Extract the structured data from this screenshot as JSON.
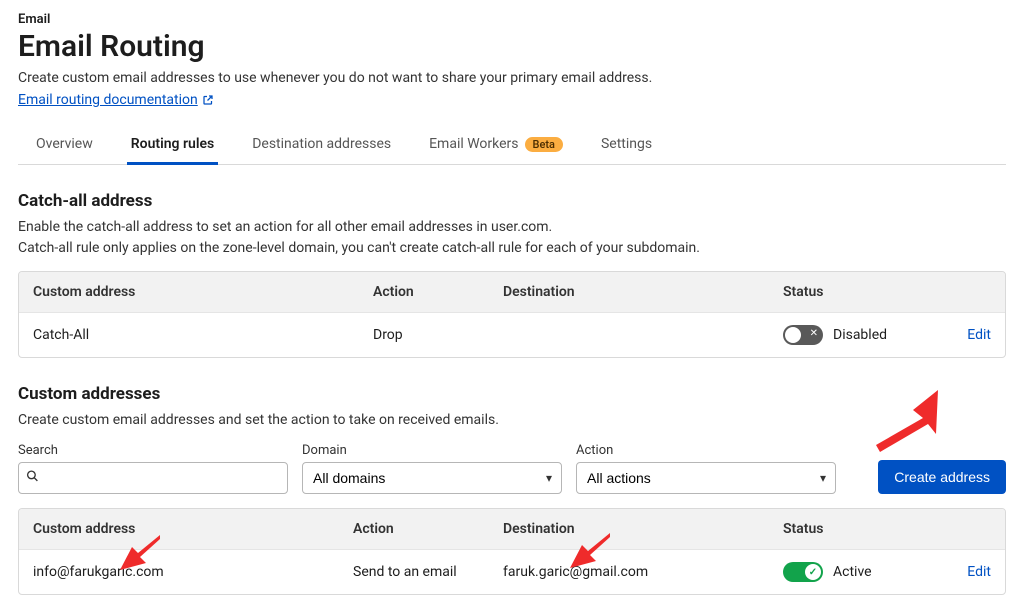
{
  "breadcrumb": "Email",
  "title": "Email Routing",
  "subtitle": "Create custom email addresses to use whenever you do not want to share your primary email address.",
  "doclink": "Email routing documentation",
  "tabs": {
    "overview": "Overview",
    "routing": "Routing rules",
    "dest": "Destination addresses",
    "workers": "Email Workers",
    "workers_badge": "Beta",
    "settings": "Settings"
  },
  "catchall": {
    "heading": "Catch-all address",
    "desc1": "Enable the catch-all address to set an action for all other email addresses in user.com.",
    "desc2": "Catch-all rule only applies on the zone-level domain, you can't create catch-all rule for each of your subdomain.",
    "headers": {
      "custom": "Custom address",
      "action": "Action",
      "dest": "Destination",
      "status": "Status"
    },
    "row": {
      "custom": "Catch-All",
      "action": "Drop",
      "dest": "",
      "status": "Disabled",
      "edit": "Edit"
    }
  },
  "custom": {
    "heading": "Custom addresses",
    "desc": "Create custom email addresses and set the action to take on received emails.",
    "filters": {
      "search_label": "Search",
      "domain_label": "Domain",
      "domain_value": "All domains",
      "action_label": "Action",
      "action_value": "All actions"
    },
    "create_btn": "Create address",
    "headers": {
      "custom": "Custom address",
      "action": "Action",
      "dest": "Destination",
      "status": "Status"
    },
    "row": {
      "custom": "info@farukgaric.com",
      "action": "Send to an email",
      "dest": "faruk.garic@gmail.com",
      "status": "Active",
      "edit": "Edit"
    }
  }
}
